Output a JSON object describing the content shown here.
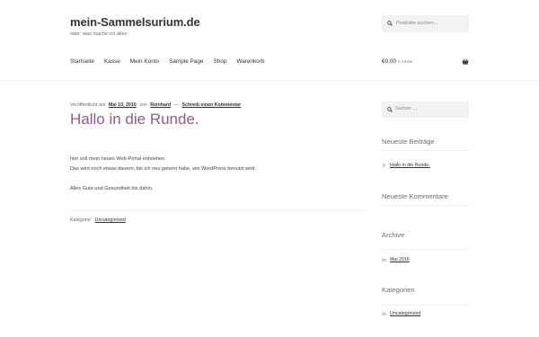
{
  "site": {
    "title": "mein-Sammelsurium.de",
    "description": "oder: was mache ich alles"
  },
  "header_search": {
    "placeholder": "Produkte suchen…",
    "icon": "search-icon"
  },
  "nav": {
    "items": [
      {
        "label": "Startseite"
      },
      {
        "label": "Kasse"
      },
      {
        "label": "Mein Konto"
      },
      {
        "label": "Sample Page"
      },
      {
        "label": "Shop"
      },
      {
        "label": "Warenkorb"
      }
    ]
  },
  "cart": {
    "amount": "€0,00",
    "items": "0 Artikel",
    "icon": "basket-icon"
  },
  "post": {
    "meta_prefix": "Veröffentlicht am",
    "date": "Mai 10, 2016",
    "meta_by": "von",
    "author": "Reinhard",
    "meta_dash": "—",
    "comment_link": "Schreib einen Kommentar",
    "title": "Hallo in die Runde.",
    "paragraphs": [
      "hier soll mein neues Web-Portal entstehen.",
      "Das wird noch etwas dauern, bis ich neu gelernt habe, wie WordPress benutzt wird.",
      "Alles Gute und Gesundheit bis dahin."
    ],
    "category_label": "Kategorie:",
    "category": "Uncategorized"
  },
  "sidebar": {
    "search_placeholder": "Suchen …",
    "recent_posts_title": "Neueste Beiträge",
    "recent_post": "Hallo in die Runde.",
    "recent_comments_title": "Neueste Kommentare",
    "archive_title": "Archive",
    "archive_item": "Mai 2016",
    "categories_title": "Kategorien",
    "category_item": "Uncategorized"
  },
  "colors": {
    "accent": "#96588a",
    "text": "#43454b",
    "link": "#333333",
    "muted": "#6d6d6d",
    "field_bg": "#f2f2f2"
  }
}
